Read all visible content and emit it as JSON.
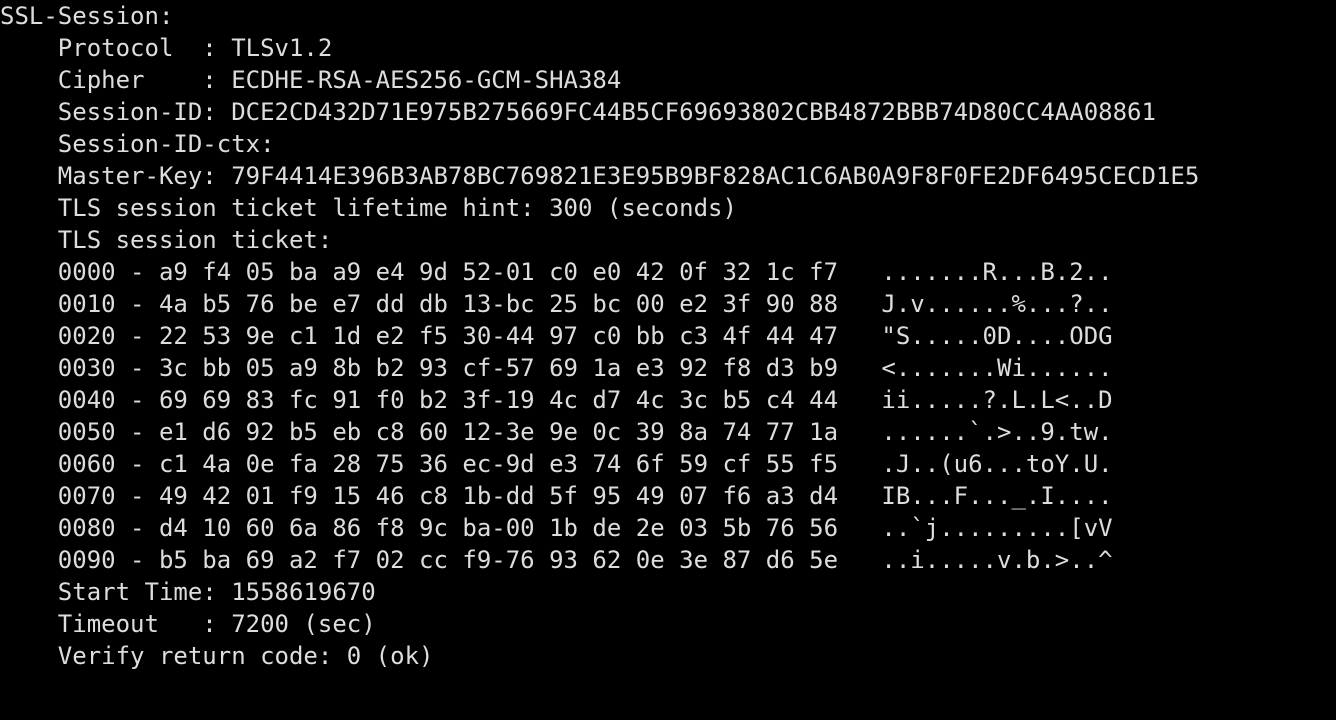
{
  "header": "SSL-Session:",
  "fields": {
    "protocol_label": "Protocol  :",
    "protocol_value": "TLSv1.2",
    "cipher_label": "Cipher    :",
    "cipher_value": "ECDHE-RSA-AES256-GCM-SHA384",
    "session_id_label": "Session-ID:",
    "session_id_value": "DCE2CD432D71E975B275669FC44B5CF69693802CBB4872BBB74D80CC4AA08861",
    "session_id_ctx_label": "Session-ID-ctx:",
    "session_id_ctx_value": "",
    "master_key_label": "Master-Key:",
    "master_key_value": "79F4414E396B3AB78BC769821E3E95B9BF828AC1C6AB0A9F8F0FE2DF6495CECD1E5",
    "ticket_hint_line": "TLS session ticket lifetime hint: 300 (seconds)",
    "ticket_header": "TLS session ticket:",
    "start_time_label": "Start Time:",
    "start_time_value": "1558619670",
    "timeout_label": "Timeout   :",
    "timeout_value": "7200 (sec)",
    "verify_label": "Verify return code:",
    "verify_value": "0 (ok)"
  },
  "ticket_rows": [
    {
      "off": "0000",
      "hex": "a9 f4 05 ba a9 e4 9d 52-01 c0 e0 42 0f 32 1c f7",
      "asc": ".......R...B.2.."
    },
    {
      "off": "0010",
      "hex": "4a b5 76 be e7 dd db 13-bc 25 bc 00 e2 3f 90 88",
      "asc": "J.v......%...?.."
    },
    {
      "off": "0020",
      "hex": "22 53 9e c1 1d e2 f5 30-44 97 c0 bb c3 4f 44 47",
      "asc": "\"S.....0D....ODG"
    },
    {
      "off": "0030",
      "hex": "3c bb 05 a9 8b b2 93 cf-57 69 1a e3 92 f8 d3 b9",
      "asc": "<.......Wi......"
    },
    {
      "off": "0040",
      "hex": "69 69 83 fc 91 f0 b2 3f-19 4c d7 4c 3c b5 c4 44",
      "asc": "ii.....?.L.L<..D"
    },
    {
      "off": "0050",
      "hex": "e1 d6 92 b5 eb c8 60 12-3e 9e 0c 39 8a 74 77 1a",
      "asc": "......`.>..9.tw."
    },
    {
      "off": "0060",
      "hex": "c1 4a 0e fa 28 75 36 ec-9d e3 74 6f 59 cf 55 f5",
      "asc": ".J..(u6...toY.U."
    },
    {
      "off": "0070",
      "hex": "49 42 01 f9 15 46 c8 1b-dd 5f 95 49 07 f6 a3 d4",
      "asc": "IB...F..._.I...."
    },
    {
      "off": "0080",
      "hex": "d4 10 60 6a 86 f8 9c ba-00 1b de 2e 03 5b 76 56",
      "asc": "..`j.........[vV"
    },
    {
      "off": "0090",
      "hex": "b5 ba 69 a2 f7 02 cc f9-76 93 62 0e 3e 87 d6 5e",
      "asc": "..i.....v.b.>..^"
    }
  ]
}
